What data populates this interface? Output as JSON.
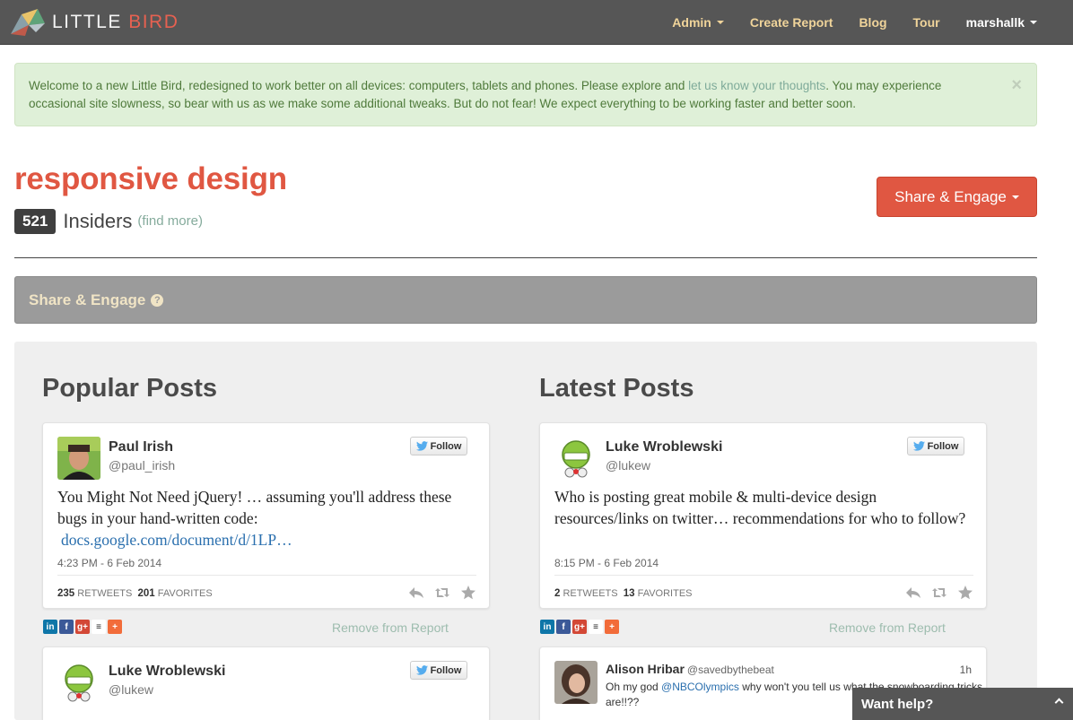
{
  "brand": {
    "text_main": "LITTLE ",
    "text_accent": "BIRD"
  },
  "nav": {
    "admin": "Admin",
    "create_report": "Create Report",
    "blog": "Blog",
    "tour": "Tour",
    "user": "marshallk"
  },
  "alert": {
    "text_before": "Welcome to a new Little Bird, redesigned to work better on all devices: computers, tablets and phones. Please explore and ",
    "link": "let us know your thoughts",
    "text_after": ". You may experience occasional site slowness, so bear with us as we make some additional tweaks. But do not fear! We expect everything to be working faster and better soon.",
    "close": "×"
  },
  "report": {
    "title": "responsive design",
    "insider_count": "521",
    "insiders_label": "Insiders",
    "find_more": "(find more)",
    "share_button": "Share & Engage"
  },
  "share_bar": {
    "label": "Share & Engage",
    "help": "?"
  },
  "columns": {
    "popular": "Popular Posts",
    "latest": "Latest Posts"
  },
  "follow_label": "Follow",
  "retweets_label": "RETWEETS",
  "favorites_label": "FAVORITES",
  "remove_label": "Remove from Report",
  "share_icon_labels": {
    "linkedin": "in",
    "facebook": "f",
    "googleplus": "g+",
    "buffer": "≡",
    "plus": "+"
  },
  "popular": [
    {
      "name": "Paul Irish",
      "handle": "@paul_irish",
      "text": "You Might Not Need jQuery! … assuming you'll address these bugs in your hand-written code:",
      "link": "docs.google.com/document/d/1LP…",
      "time": "4:23 PM - 6 Feb 2014",
      "retweets": "235",
      "favorites": "201"
    },
    {
      "name": "Luke Wroblewski",
      "handle": "@lukew"
    }
  ],
  "latest": [
    {
      "name": "Luke Wroblewski",
      "handle": "@lukew",
      "text": "Who is posting great mobile & multi-device design resources/links on twitter… recommendations for who to follow?",
      "time": "8:15 PM - 6 Feb 2014",
      "retweets": "2",
      "favorites": "13"
    },
    {
      "name": "Alison Hribar",
      "handle": "@savedbythebeat",
      "time": "1h",
      "text_before": "Oh my god ",
      "mention": "@NBCOlympics",
      "text_after": " why won't you tell us what the snowboarding tricks are!!??"
    }
  ],
  "help_tab": {
    "label": "Want help?"
  },
  "colors": {
    "accent": "#e05742",
    "nav_link": "#f0d49a",
    "alert_bg": "#dff0d8",
    "link_teal": "#85ab9c"
  }
}
